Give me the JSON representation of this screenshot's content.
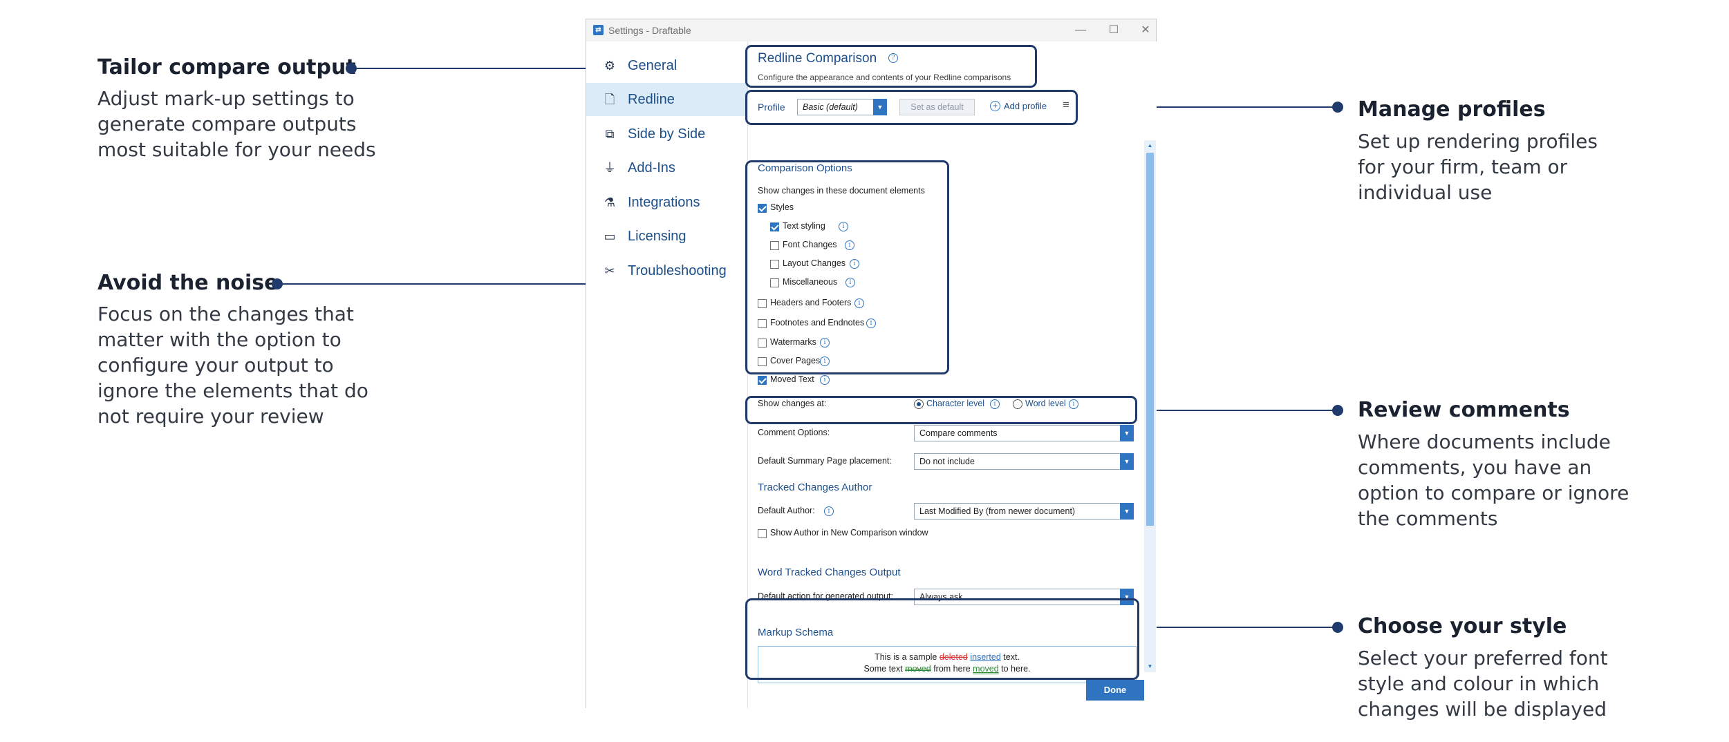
{
  "callouts": {
    "tailor": {
      "title": "Tailor compare output",
      "lines": [
        "Adjust mark-up settings to",
        "generate compare outputs",
        "most suitable for your needs"
      ]
    },
    "noise": {
      "title": "Avoid the noise",
      "lines": [
        "Focus on the changes that",
        "matter with the option to",
        "configure your output to",
        "ignore the elements that do",
        "not require your review"
      ]
    },
    "profiles": {
      "title": "Manage profiles",
      "lines": [
        "Set up rendering profiles",
        "for your firm, team or",
        "individual use"
      ]
    },
    "comments": {
      "title": "Review comments",
      "lines": [
        "Where documents include",
        "comments, you have an",
        "option to compare or ignore",
        "the comments"
      ]
    },
    "style": {
      "title": "Choose your style",
      "lines": [
        "Select your preferred font",
        "style and colour in which",
        "changes will be displayed"
      ]
    }
  },
  "window": {
    "title": "Settings - Draftable",
    "controls": {
      "minimize": "—",
      "maximize": "☐",
      "close": "✕"
    }
  },
  "sidebar": {
    "items": [
      {
        "label": "General",
        "icon": "gear-icon",
        "glyph": "⚙"
      },
      {
        "label": "Redline",
        "icon": "document-icon",
        "glyph": "🗋",
        "active": true
      },
      {
        "label": "Side by Side",
        "icon": "pages-icon",
        "glyph": "⧉"
      },
      {
        "label": "Add-Ins",
        "icon": "plug-icon",
        "glyph": "⏚"
      },
      {
        "label": "Integrations",
        "icon": "integrations-icon",
        "glyph": "⚗"
      },
      {
        "label": "Licensing",
        "icon": "card-icon",
        "glyph": "▭"
      },
      {
        "label": "Troubleshooting",
        "icon": "tools-icon",
        "glyph": "✂"
      }
    ]
  },
  "panel": {
    "title": "Redline Comparison",
    "subtitle": "Configure the appearance and contents of your Redline comparisons",
    "profile": {
      "label": "Profile",
      "value": "Basic (default)",
      "set_default": "Set as default",
      "add_profile": "Add profile",
      "menu_glyph": "≡"
    },
    "comparison_options": {
      "heading": "Comparison Options",
      "group_label": "Show changes in these document elements",
      "items": [
        {
          "label": "Styles",
          "checked": true,
          "indent": 0,
          "info": false
        },
        {
          "label": "Text styling",
          "checked": true,
          "indent": 1,
          "info": true
        },
        {
          "label": "Font Changes",
          "checked": false,
          "indent": 1,
          "info": true
        },
        {
          "label": "Layout Changes",
          "checked": false,
          "indent": 1,
          "info": true
        },
        {
          "label": "Miscellaneous",
          "checked": false,
          "indent": 1,
          "info": true
        },
        {
          "label": "Headers and Footers",
          "checked": false,
          "indent": 0,
          "info": true
        },
        {
          "label": "Footnotes and Endnotes",
          "checked": false,
          "indent": 0,
          "info": true
        },
        {
          "label": "Watermarks",
          "checked": false,
          "indent": 0,
          "info": true
        },
        {
          "label": "Cover Pages",
          "checked": false,
          "indent": 0,
          "info": true
        },
        {
          "label": "Moved Text",
          "checked": true,
          "indent": 0,
          "info": true
        }
      ]
    },
    "show_changes_at": {
      "label": "Show changes at:",
      "options": [
        {
          "label": "Character level",
          "selected": true
        },
        {
          "label": "Word level",
          "selected": false
        }
      ]
    },
    "comment_options": {
      "label": "Comment Options:",
      "value": "Compare comments"
    },
    "summary_page": {
      "label": "Default Summary Page placement:",
      "value": "Do not include"
    },
    "tracked_author": {
      "heading": "Tracked Changes Author",
      "label": "Default Author:",
      "value": "Last Modified By (from newer document)",
      "checkbox_label": "Show Author in New Comparison window"
    },
    "word_output": {
      "heading": "Word Tracked Changes Output",
      "label": "Default action for generated output:",
      "value": "Always ask"
    },
    "markup_schema": {
      "heading": "Markup Schema",
      "line1": {
        "before": "This is a sample ",
        "deleted": "deleted",
        "mid": " ",
        "inserted": "inserted",
        "after": " text."
      },
      "line2": {
        "before": "Some text ",
        "moved_from": "moved",
        "mid": " from here ",
        "moved_to": "moved",
        "after": " to here."
      }
    },
    "done_label": "Done"
  },
  "colors": {
    "accent": "#2f74c0",
    "callout": "#1f3a6b",
    "nav_text": "#1d4f8b",
    "active_nav": "#dcebf8",
    "deleted": "#dd3333",
    "moved": "#2f8a3a"
  }
}
